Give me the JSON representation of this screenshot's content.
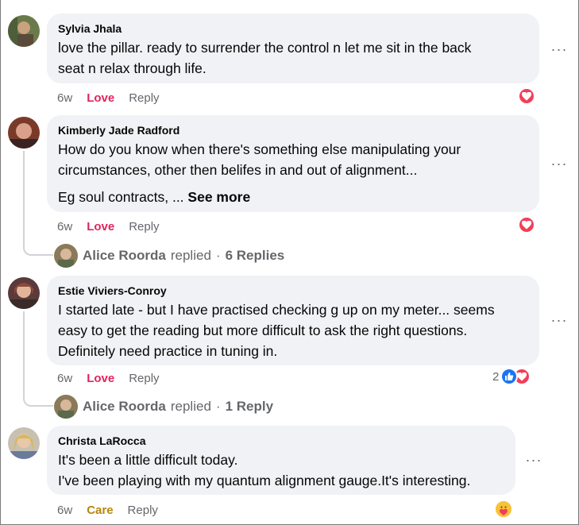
{
  "comments": [
    {
      "author": "Sylvia Jhala",
      "lines": [
        "love the pillar. ready to surrender the control n let me sit in the back",
        "seat n relax through life."
      ],
      "time": "6w",
      "reaction_label": "Love",
      "reply_label": "Reply",
      "reactions": {
        "count": "",
        "icons": [
          "love-icon"
        ]
      }
    },
    {
      "author": "Kimberly Jade Radford",
      "lines": [
        "How do you know when there's something else manipulating your",
        "circumstances, other then belifes in and out of alignment..."
      ],
      "extra": "Eg soul contracts, ...",
      "see_more": "See more",
      "time": "6w",
      "reaction_label": "Love",
      "reply_label": "Reply",
      "reactions": {
        "count": "",
        "icons": [
          "love-icon"
        ]
      },
      "replies": {
        "name": "Alice Roorda",
        "text": "replied",
        "sep": "·",
        "count": "6 Replies"
      }
    },
    {
      "author": "Estie Viviers-Conroy",
      "lines": [
        "I started late - but I have practised checking g up on my meter... seems",
        "easy to get the reading but more difficult to ask the right questions.",
        "Definitely need practice in tuning in."
      ],
      "time": "6w",
      "reaction_label": "Love",
      "reply_label": "Reply",
      "reactions": {
        "count": "2",
        "icons": [
          "like-icon",
          "love-icon"
        ]
      },
      "replies": {
        "name": "Alice Roorda",
        "text": "replied",
        "sep": "·",
        "count": "1 Reply"
      }
    },
    {
      "author": "Christa LaRocca",
      "lines": [
        "It's been a little difficult today.",
        "I've been playing with my quantum alignment gauge.It's interesting."
      ],
      "time": "6w",
      "reaction_label": "Care",
      "reply_label": "Reply",
      "reactions": {
        "count": "",
        "icons": [
          "care-icon"
        ]
      }
    }
  ],
  "more_glyph": "···",
  "colors": {
    "bubble": "#f0f2f5",
    "love": "#e0245e",
    "like": "#1877f2",
    "care": "#b8860b",
    "meta": "#65676b"
  }
}
